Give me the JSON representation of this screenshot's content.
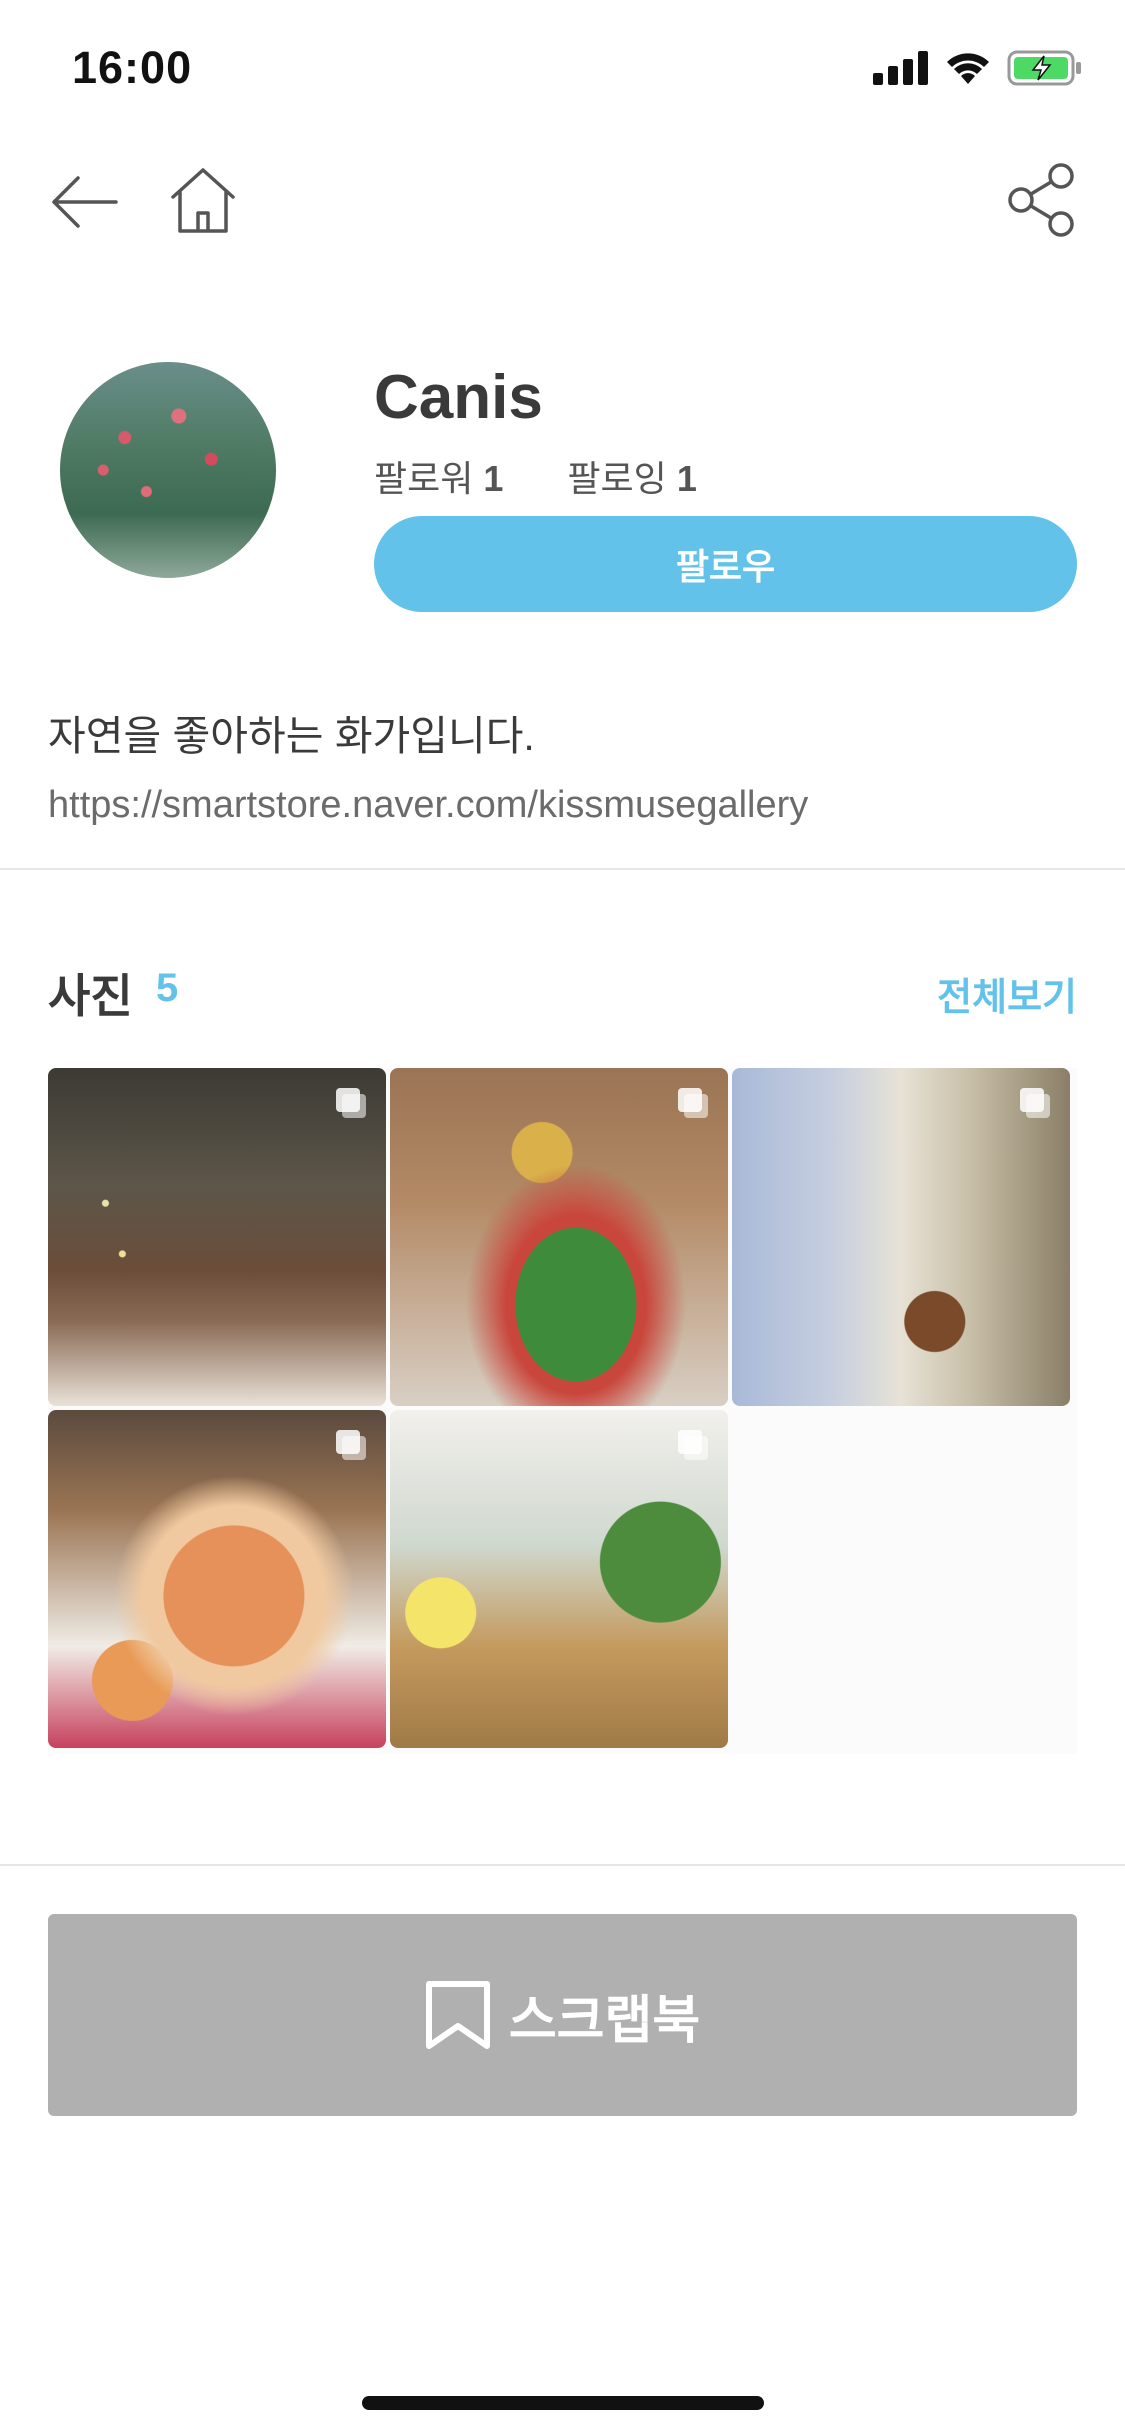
{
  "status_bar": {
    "time": "16:00"
  },
  "nav": {
    "back": "back-arrow",
    "home": "home",
    "share": "share"
  },
  "profile": {
    "name": "Canis",
    "followers_label": "팔로워",
    "followers_count": "1",
    "following_label": "팔로잉",
    "following_count": "1",
    "follow_button": "팔로우",
    "bio": "자연을 좋아하는 화가입니다.",
    "link": "https://smartstore.naver.com/kissmusegallery"
  },
  "photos_section": {
    "title": "사진",
    "count": "5",
    "see_all": "전체보기",
    "items": [
      {
        "alt": "living room with christmas tree"
      },
      {
        "alt": "table with fruit and salad"
      },
      {
        "alt": "dining table by window"
      },
      {
        "alt": "sushi on floral tablecloth"
      },
      {
        "alt": "lemonade on rattan table"
      }
    ]
  },
  "scrapbook_button": "스크랩북",
  "colors": {
    "accent": "#62c2ea",
    "disabled": "#b0b0b0",
    "text": "#3a3a3a"
  }
}
